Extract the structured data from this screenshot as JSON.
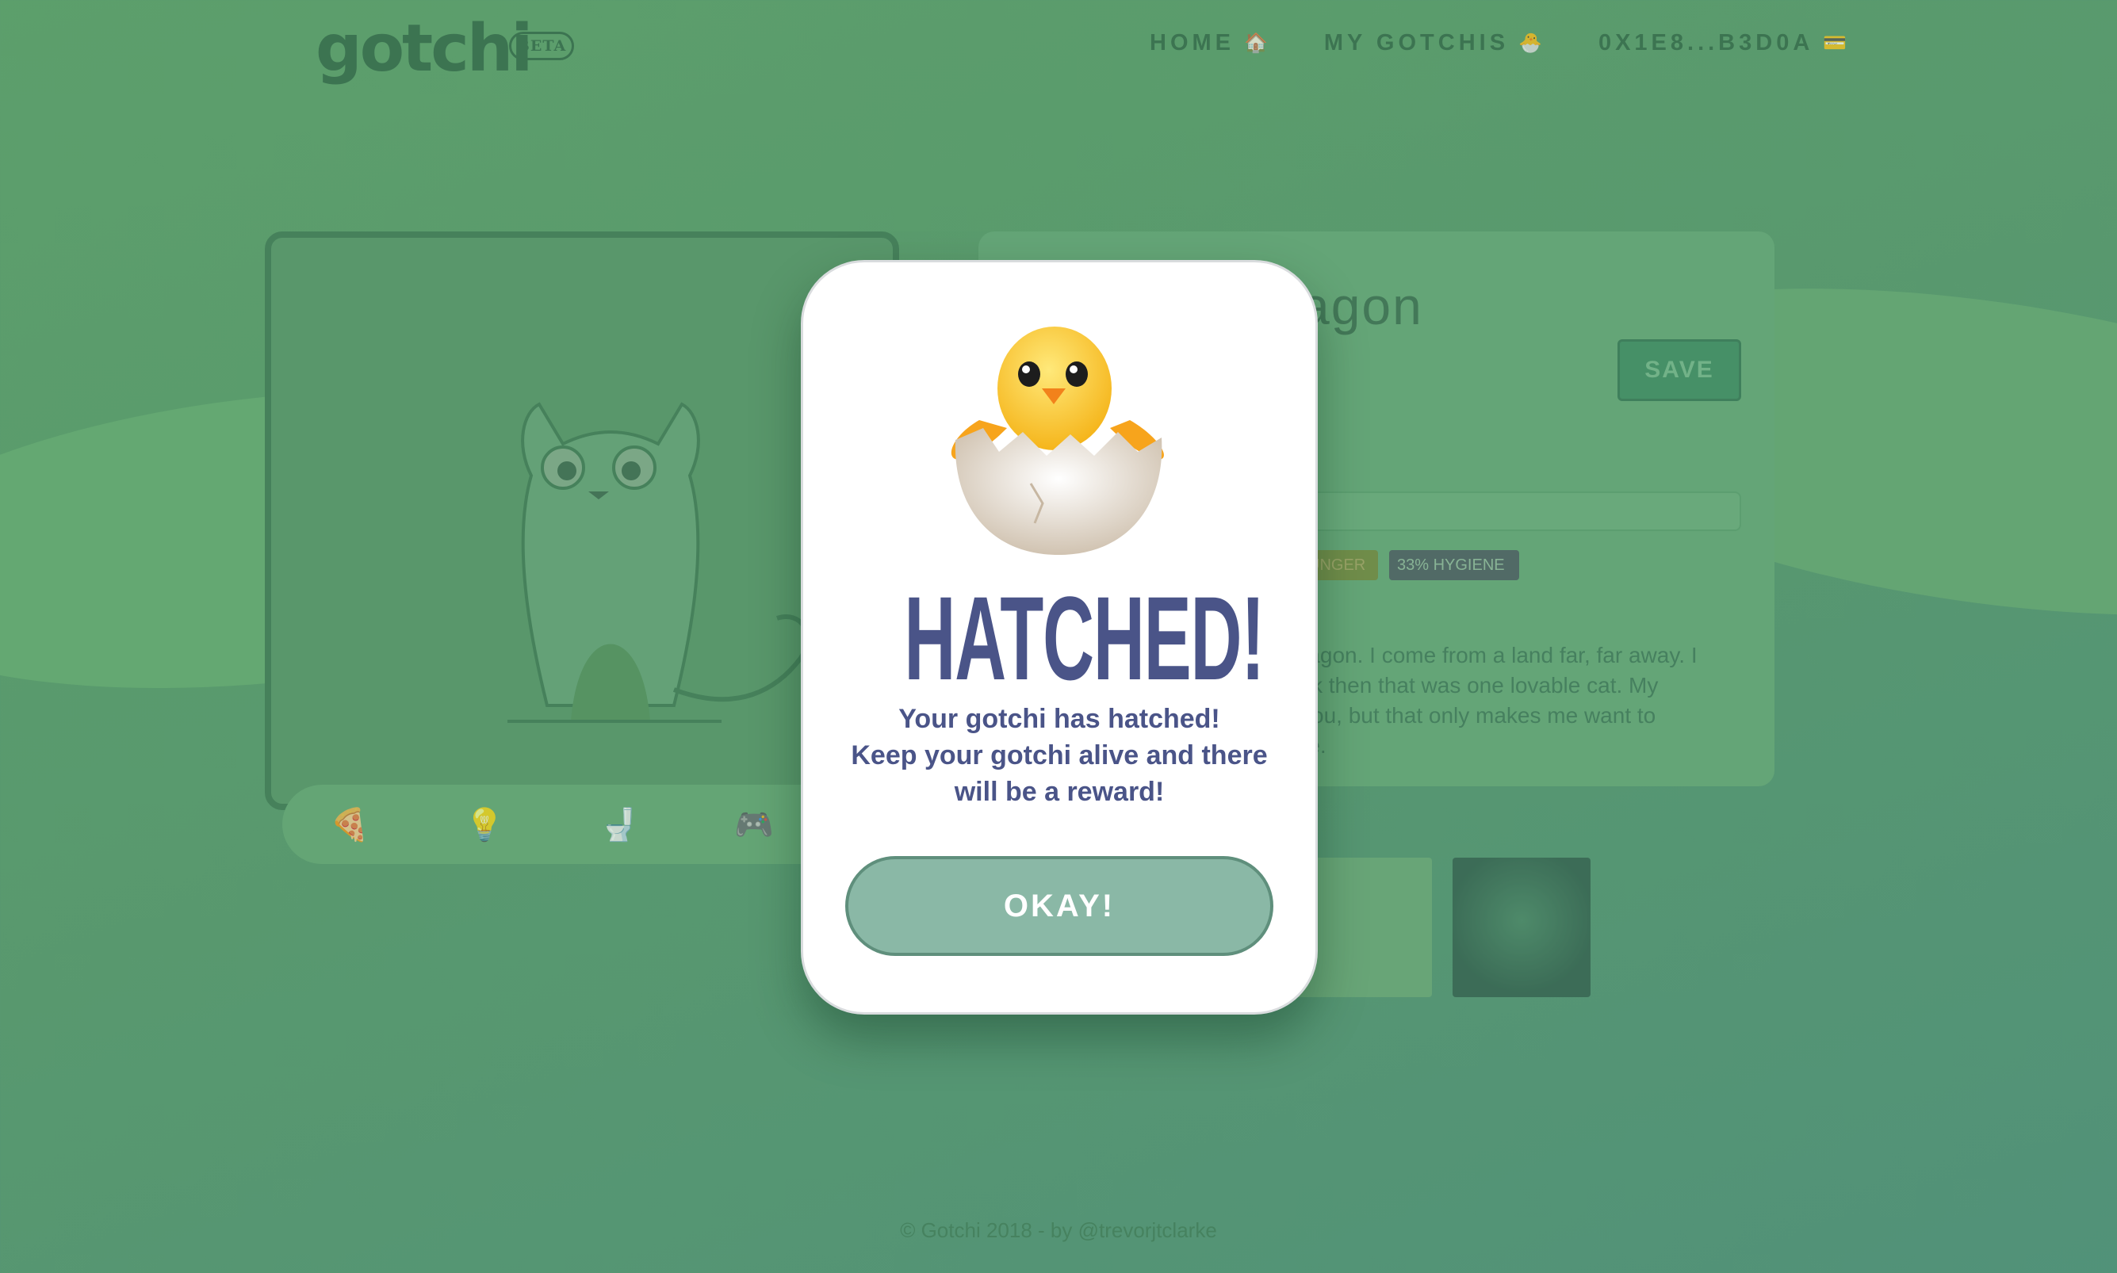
{
  "header": {
    "logo": "gotchi",
    "beta_badge": "BETA",
    "nav": [
      {
        "label": "HOME",
        "icon": "house-icon",
        "glyph": "🏠"
      },
      {
        "label": "MY GOTCHIS",
        "icon": "hatching-chick-icon",
        "glyph": "🐣"
      },
      {
        "label": "0X1E8...B3D0A",
        "icon": "card-icon",
        "glyph": "💳"
      }
    ]
  },
  "pet_card": {
    "actions": [
      {
        "name": "feed-button",
        "icon": "pizza-icon",
        "glyph": "🍕"
      },
      {
        "name": "light-button",
        "icon": "lightbulb-icon",
        "glyph": "💡"
      },
      {
        "name": "toilet-button",
        "icon": "toilet-icon",
        "glyph": "🚽"
      },
      {
        "name": "play-button",
        "icon": "gamepad-icon",
        "glyph": "🎮"
      }
    ]
  },
  "details": {
    "name_fragment": "agon",
    "save_label": "SAVE",
    "hunger_badge": "UNGER",
    "hygiene_badge": "33%   HYGIENE",
    "bio_lines": [
      "ragon. I come from a land far, far away. I",
      "ck then that was one lovable cat. My",
      "you, but that only makes me want to",
      "re."
    ]
  },
  "modal": {
    "icon": "hatching-chick-icon",
    "title": "HATCHED!",
    "message_lines": [
      "Your gotchi has hatched!",
      "Keep your gotchi alive and there",
      "will be a reward!"
    ],
    "okay_label": "OKAY!"
  },
  "footer": {
    "text": "© Gotchi 2018 - by @trevorjtclarke"
  },
  "colors": {
    "background": "#4a9160",
    "modal_text": "#4a5488",
    "okay_button": "#8ab8a6"
  }
}
